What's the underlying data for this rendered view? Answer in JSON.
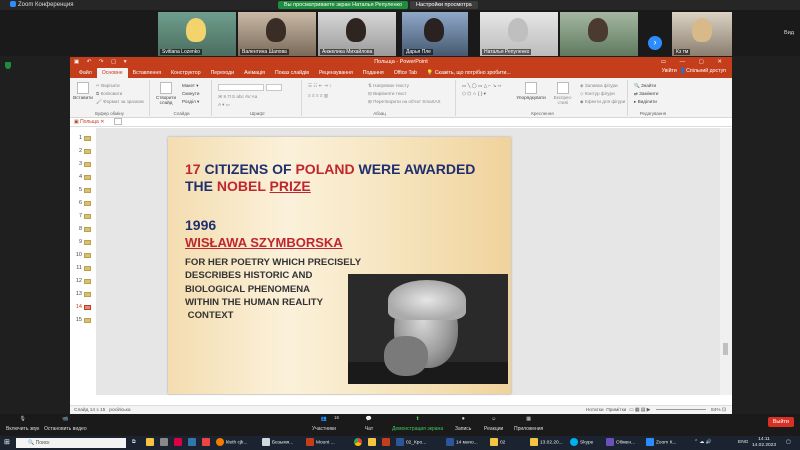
{
  "zoom": {
    "window_title": "Zoom Конференция",
    "share_status": "Вы просматриваете экран Наталья Репуленко",
    "view_options": "Настройки просмотра",
    "view_label": "Вид",
    "participants": [
      {
        "name": "Svitlana Lozenko"
      },
      {
        "name": "Валентина Шапова"
      },
      {
        "name": "Анжелика Михайлова"
      },
      {
        "name": "Дарья Пле"
      },
      {
        "name": "Наталья Репуленко"
      },
      {
        "name": ""
      },
      {
        "name": "Кз тм"
      }
    ],
    "controls": {
      "audio": "Включить звук",
      "video": "Остановить видео",
      "participants": "Участники",
      "participants_count": "16",
      "chat": "Чат",
      "share": "Демонстрация экрана",
      "record": "Запись",
      "reactions": "Реакции",
      "apps": "Приложения",
      "leave": "Выйти"
    }
  },
  "powerpoint": {
    "title": "Польща - PowerPoint",
    "tabs": [
      "Файл",
      "Основне",
      "Вставлення",
      "Конструктор",
      "Переходи",
      "Анімація",
      "Показ слайдів",
      "Рецензування",
      "Подання",
      "Office Tab"
    ],
    "active_tab": "Основне",
    "tell_me": "Скажіть, що потрібно зробити...",
    "sign_in": "Увійти",
    "share": "Спільний доступ",
    "ribbon": {
      "clipboard": {
        "paste": "Вставити",
        "cut": "Вирізати",
        "copy": "Копіювати",
        "format_painter": "Формат за зразком",
        "label": "Буфер обміну"
      },
      "slides": {
        "new_slide": "Створити слайд",
        "layout": "Макет",
        "reset": "Скинути",
        "section": "Розділ",
        "label": "Слайди"
      },
      "font": {
        "label": "Шрифт"
      },
      "paragraph": {
        "text_direction": "Напрямок тексту",
        "align_text": "Вирівняти текст",
        "smartart": "Перетворити на об'єкт SmartArt",
        "label": "Абзац"
      },
      "drawing": {
        "arrange": "Упорядкувати",
        "quick_styles": "Експрес-стилі",
        "fill": "Заливка фігури",
        "outline": "Контур фігури",
        "effects": "Ефекти для фігури",
        "label": "Креслення"
      },
      "editing": {
        "find": "Знайти",
        "replace": "Замінити",
        "select": "Виділити",
        "label": "Редагування"
      }
    },
    "doc_tab": "Польща",
    "slide_numbers": [
      "1",
      "2",
      "3",
      "4",
      "5",
      "6",
      "7",
      "8",
      "9",
      "10",
      "11",
      "12",
      "13",
      "14",
      "15"
    ],
    "selected_slide": "14",
    "status": {
      "slide_of": "Слайд 14 з 15",
      "language": "російська",
      "notes": "Нотатки",
      "comments": "Примітки",
      "zoom": "84%"
    }
  },
  "slide": {
    "heading_parts": [
      {
        "text": "17 ",
        "color": "red"
      },
      {
        "text": "CITIZENS OF ",
        "color": "blue"
      },
      {
        "text": "POLAND",
        "color": "red"
      },
      {
        "text": " WERE   AWARDED THE ",
        "color": "blue"
      },
      {
        "text": "NOBEL",
        "color": "red"
      },
      {
        "text": " ",
        "color": "blue"
      },
      {
        "text": "PRIZE",
        "color": "red"
      }
    ],
    "year": "1996",
    "laureate": "WISŁAWA SZYMBORSKA",
    "description_lines": [
      "FOR HER POETRY WHICH PRECISELY",
      "DESCRIBES HISTORIC AND",
      "BIOLOGICAL PHENOMENA",
      "WITHIN THE HUMAN REALITY",
      " CONTEXT"
    ]
  },
  "taskbar": {
    "search_placeholder": "Поиск",
    "items": [
      "kleth cjk...",
      "Безымя...",
      "Mount ...",
      "02_Кро...",
      "14 мачо...",
      "02",
      "13.02.20...",
      "Skype",
      "Обмен...",
      "Zoom К..."
    ],
    "language": "ENG",
    "time": "14:11",
    "date": "14.02.2023"
  },
  "colors": {
    "ppt_accent": "#c43e1c",
    "slide_blue": "#1f2f6e",
    "slide_red": "#c0262e",
    "zoom_blue": "#2d8cff",
    "zoom_green": "#1e8e3e"
  }
}
